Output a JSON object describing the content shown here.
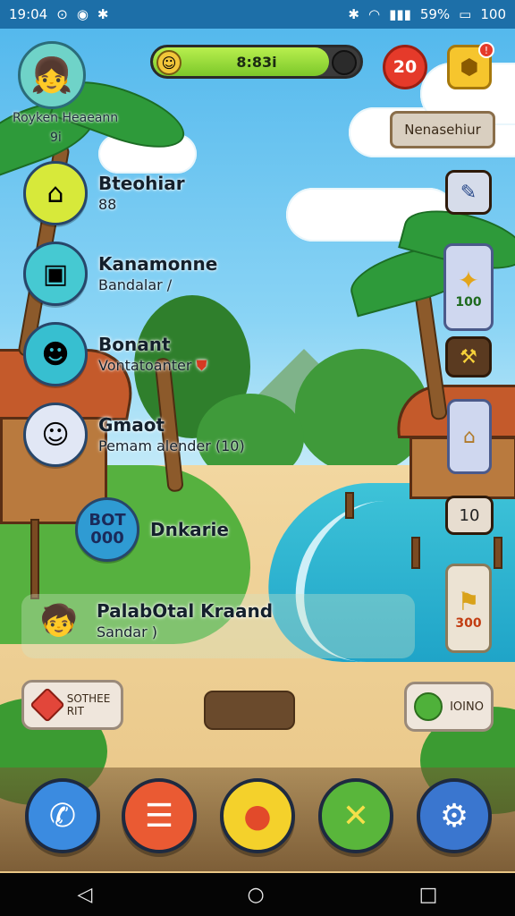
{
  "status_bar": {
    "time": "19:04",
    "battery_percent": "59%",
    "battery_level": "100"
  },
  "player": {
    "name": "Royken Heaeann",
    "level": "9i"
  },
  "xp_bar": {
    "text": "8:83i",
    "fill_fraction": 0.85
  },
  "energy": {
    "value": "20"
  },
  "gift": {
    "notification": "!"
  },
  "notice_button": {
    "label": "Nenasehiur"
  },
  "menu": {
    "items": [
      {
        "title": "Bteohiar",
        "sub": "88",
        "icon": "house-icon",
        "color": "#d7e93a"
      },
      {
        "title": "Kanamonne",
        "sub": "Bandalar /",
        "icon": "map-scroll-icon",
        "color": "#46c9d2"
      },
      {
        "title": "Bonant",
        "sub": "Vontatoanter",
        "icon": "blocky-face-icon",
        "color": "#37bfd0"
      },
      {
        "title": "Gmaot",
        "sub": "Pemam alender (10)",
        "icon": "character-icon",
        "color": "#e1e7f5"
      },
      {
        "title": "Dnkarie",
        "sub": "",
        "icon": "coin-badge-icon",
        "color": "#2f9bd3",
        "badge_top": "BOT",
        "badge_bottom": "000"
      },
      {
        "title": "PalabOtal Kraand",
        "sub": "Sandar )",
        "icon": "boy-avatar-icon",
        "color": "transparent"
      }
    ]
  },
  "side_buttons": {
    "edit_label": "",
    "quest_value": "100",
    "shop_value": "",
    "card_value": "10",
    "tool_value": "300"
  },
  "bottom": {
    "left_button_label": "SOTHEE\nRIT",
    "right_button_label": "IOINO"
  },
  "dock": [
    {
      "name": "phone",
      "color": "#3b8be0",
      "icon": "phone-icon"
    },
    {
      "name": "messages",
      "color": "#ea5a33",
      "icon": "message-board-icon"
    },
    {
      "name": "chat",
      "color": "#f4d12b",
      "icon": "chat-bubble-icon"
    },
    {
      "name": "tools",
      "color": "#59b63b",
      "icon": "wrench-icon"
    },
    {
      "name": "settings",
      "color": "#3a76cf",
      "icon": "gear-icon"
    }
  ]
}
